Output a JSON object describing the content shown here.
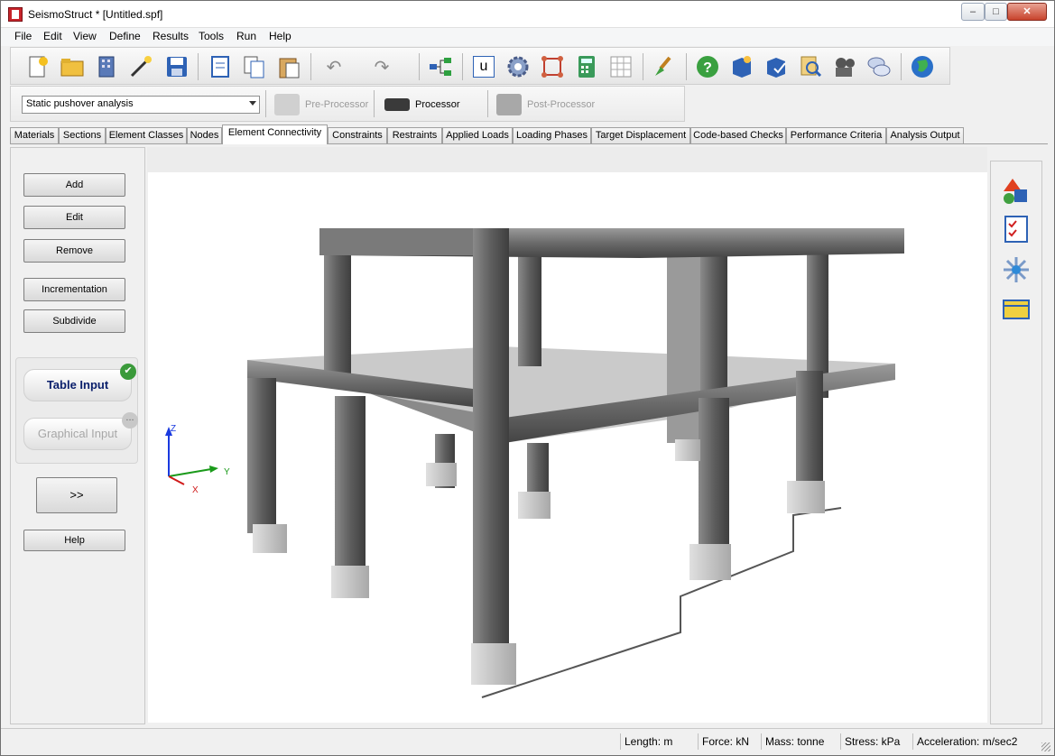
{
  "window": {
    "title": "SeismoStruct * [Untitled.spf]"
  },
  "menu": [
    "File",
    "Edit",
    "View",
    "Define",
    "Results",
    "Tools",
    "Run",
    "Help"
  ],
  "toolbar": {
    "icons": [
      "new-file-icon",
      "open-folder-icon",
      "building-wizard-icon",
      "magic-wand-icon",
      "save-icon",
      "report-icon",
      "copy-icon",
      "paste-icon",
      "undo-icon",
      "redo-icon",
      "tree-icon",
      "units-icon",
      "settings-gear-icon",
      "model-check-icon",
      "calculator-icon",
      "grid-icon",
      "paint-brush-icon",
      "help-icon",
      "manual-book-icon",
      "examples-book-icon",
      "search-icon",
      "video-icon",
      "forum-icon",
      "website-globe-icon"
    ],
    "units_label": "u"
  },
  "mode": {
    "analysis_type": "Static pushover analysis",
    "pre_processor": "Pre-Processor",
    "processor": "Processor",
    "post_processor": "Post-Processor"
  },
  "tabs": [
    "Materials",
    "Sections",
    "Element Classes",
    "Nodes",
    "Element Connectivity",
    "Constraints",
    "Restraints",
    "Applied Loads",
    "Loading Phases",
    "Target Displacement",
    "Code-based Checks",
    "Performance Criteria",
    "Analysis Output"
  ],
  "active_tab": "Element Connectivity",
  "left_panel": {
    "add": "Add",
    "edit": "Edit",
    "remove": "Remove",
    "incrementation": "Incrementation",
    "subdivide": "Subdivide",
    "table_input": "Table Input",
    "graphical_input": "Graphical Input",
    "expand": ">>",
    "help": "Help",
    "table_badge": "✔",
    "graphical_badge": "..."
  },
  "axes": {
    "z": "Z",
    "y": "Y",
    "x": "X"
  },
  "right_panel": [
    "shapes-icon",
    "checklist-icon",
    "node-star-icon",
    "section-frame-icon"
  ],
  "status": {
    "length": "Length: m",
    "force": "Force: kN",
    "mass": "Mass: tonne",
    "stress": "Stress: kPa",
    "acceleration": "Acceleration: m/sec2"
  },
  "colors": {
    "structure": "#6e6e6e",
    "slab": "#a8a8a8",
    "accent_check": "#3a9a3a",
    "table_input_text": "#0a1f6b"
  }
}
